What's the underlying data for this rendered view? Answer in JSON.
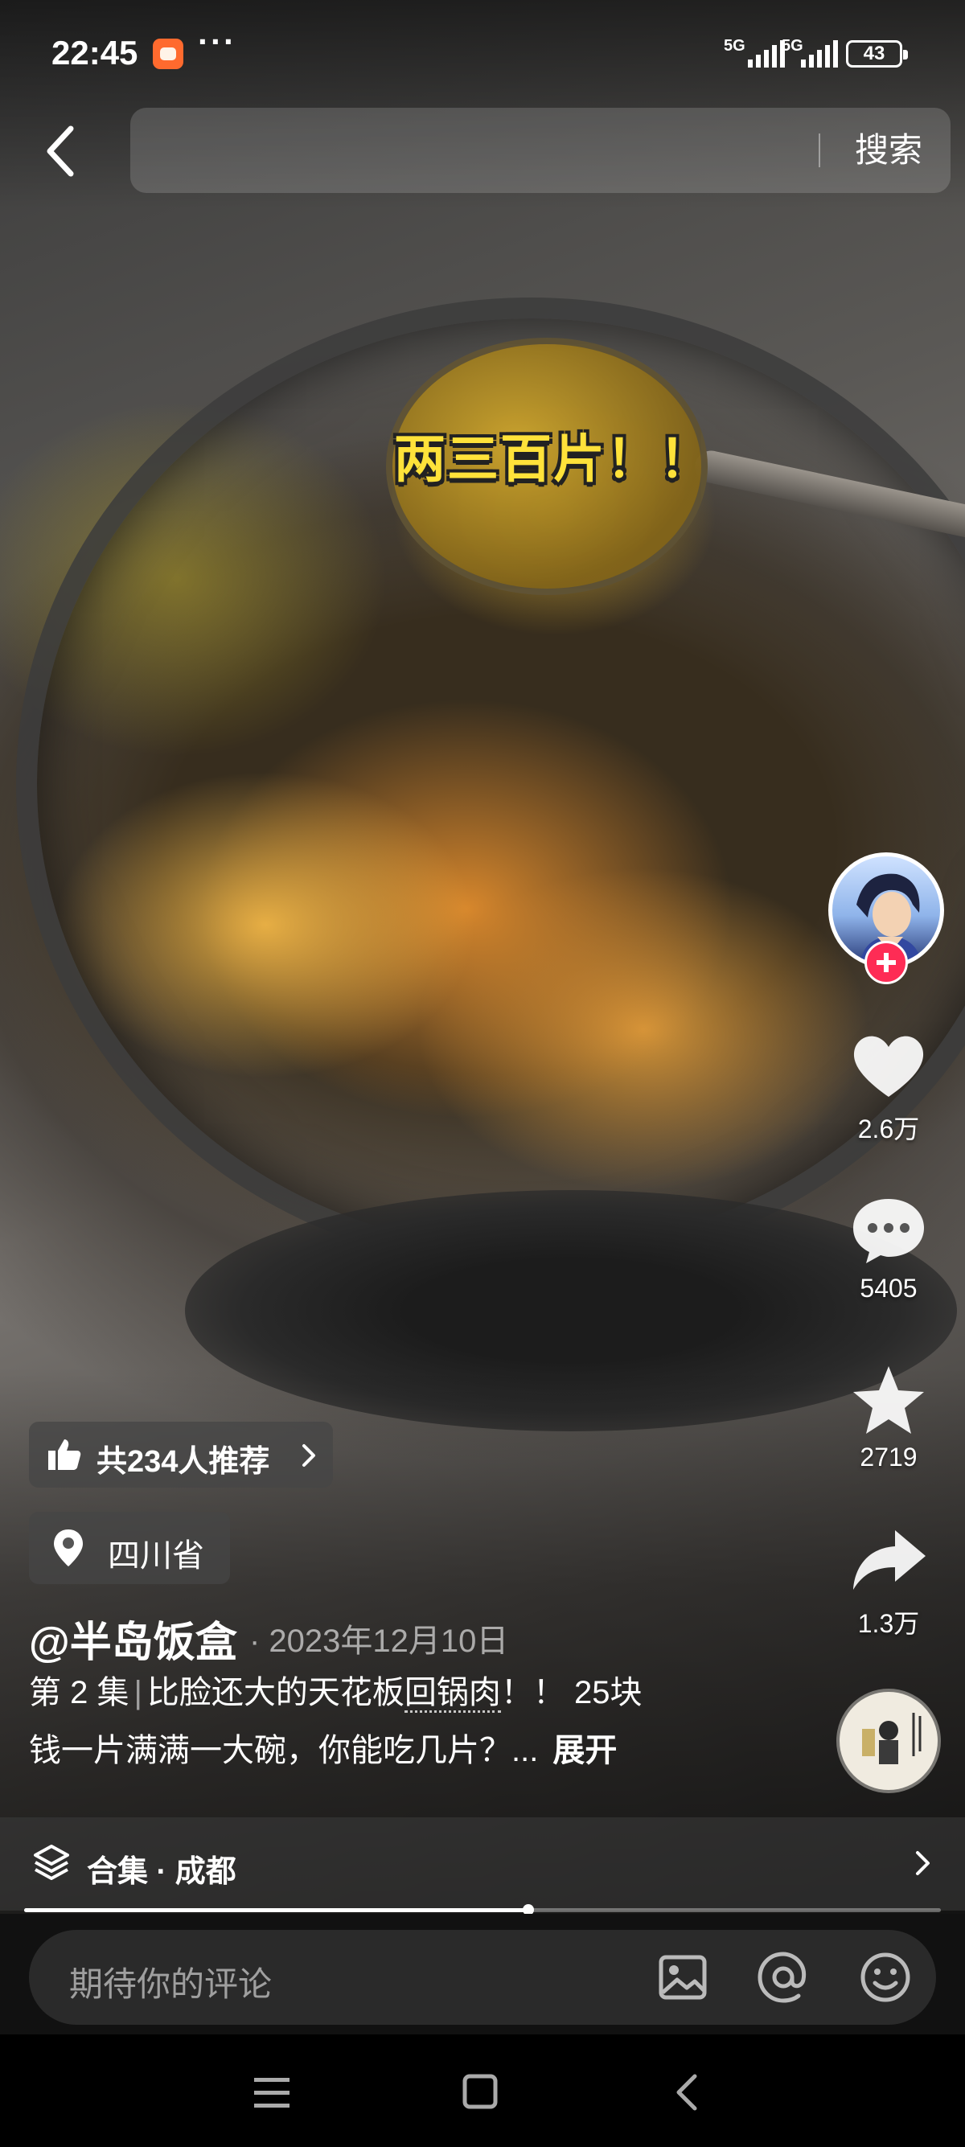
{
  "status_bar": {
    "time": "22:45",
    "more": "···",
    "network_1": "5G",
    "network_2": "5G",
    "battery": "43"
  },
  "search": {
    "placeholder": "",
    "button_label": "搜索"
  },
  "video": {
    "caption": "两三百片！！"
  },
  "rail": {
    "like_count": "2.6万",
    "comment_count": "5405",
    "favorite_count": "2719",
    "share_count": "1.3万"
  },
  "info": {
    "recommend_label": "共234人推荐",
    "location": "四川省",
    "author": "@半岛饭盒",
    "date": "· 2023年12月10日",
    "episode": "第 2 集",
    "title_part1": "比脸还大的天花板",
    "title_link": "回锅肉",
    "title_part2": "！！ 25块",
    "desc_line2": "钱一片满满一大碗，你能吃几片？...",
    "expand": "展开"
  },
  "collection": {
    "label": "合集 · 成都"
  },
  "playback": {
    "progress": 0.55
  },
  "comment": {
    "placeholder": "期待你的评论"
  },
  "colors": {
    "accent_red": "#fe2c55",
    "caption_yellow": "#ffe23a"
  },
  "icons": [
    "back-arrow-icon",
    "heart-icon",
    "comment-bubble-icon",
    "star-icon",
    "share-arrow-icon",
    "thumbs-up-icon",
    "location-pin-icon",
    "layers-icon",
    "chevron-right-icon",
    "image-icon",
    "at-icon",
    "emoji-icon",
    "menu-icon",
    "home-square-icon",
    "back-triangle-icon"
  ]
}
